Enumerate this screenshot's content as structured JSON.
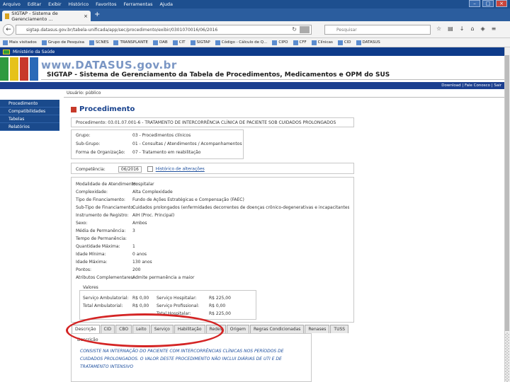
{
  "browser": {
    "menu": [
      "Arquivo",
      "Editar",
      "Exibir",
      "Histórico",
      "Favoritos",
      "Ferramentas",
      "Ajuda"
    ],
    "tab_title": "SIGTAP - Sistema de Gerenciamento ...",
    "url": "sigtap.datasus.gov.br/tabela-unificada/app/sec/procedimento/exibir/0301070016/06/2016",
    "search_placeholder": "Pesquisar",
    "bookmarks": [
      "Mais visitados",
      "Grupo de Pesquisa",
      "SCNES",
      "TRANSPLANTE",
      "DAB",
      "CIT",
      "SIGTAP",
      "Código - Cálculo de Q...",
      "CIPO",
      "CFF",
      "Clínicas",
      "CID",
      "DATASUS"
    ]
  },
  "page": {
    "gov_label": "Ministério da Saúde",
    "brand": "www.DATASUS.gov.br",
    "system_title": "SIGTAP - Sistema de Gerenciamento da Tabela de Procedimentos, Medicamentos e OPM do SUS",
    "top_links": "Download | Fale Conosco | Sair",
    "user": "Usuário: público",
    "sidebar": [
      "Procedimento",
      "Compatibilidades",
      "Tabelas",
      "Relatórios"
    ],
    "title": "Procedimento",
    "procedure": {
      "label": "Procedimento:",
      "value": "03.01.07.001-6 - TRATAMENTO DE INTERCORRÊNCIA CLÍNICA DE PACIENTE SOB CUIDADOS PROLONGADOS"
    },
    "hierarchy": [
      {
        "label": "Grupo:",
        "value": "03 - Procedimentos clínicos"
      },
      {
        "label": "Sub-Grupo:",
        "value": "01 - Consultas / Atendimentos / Acompanhamentos"
      },
      {
        "label": "Forma de Organização:",
        "value": "07 - Tratamento em reabilitação"
      }
    ],
    "competencia": {
      "label": "Competência:",
      "value": "06/2016",
      "history_label": "Histórico de alterações"
    },
    "attributes": [
      {
        "label": "Modalidade de Atendimento:",
        "value": "Hospitalar"
      },
      {
        "label": "Complexidade:",
        "value": "Alta Complexidade"
      },
      {
        "label": "Tipo de Financiamento:",
        "value": "Fundo de Ações Estratégicas e Compensação (FAEC)"
      },
      {
        "label": "Sub-Tipo de Financiamento:",
        "value": "Cuidados prolongados (enfermidades decorrentes de doenças crônico-degenerativas e incapacitantes)"
      },
      {
        "label": "Instrumento de Registro:",
        "value": "AIH (Proc. Principal)"
      },
      {
        "label": "Sexo:",
        "value": "Ambos"
      },
      {
        "label": "Média de Permanência:",
        "value": "3"
      },
      {
        "label": "Tempo de Permanência:",
        "value": ""
      },
      {
        "label": "Quantidade Máxima:",
        "value": "1"
      },
      {
        "label": "Idade Mínima:",
        "value": "0 anos"
      },
      {
        "label": "Idade Máxima:",
        "value": "130 anos"
      },
      {
        "label": "Pontos:",
        "value": "200"
      },
      {
        "label": "Atributos Complementares:",
        "value": "Admite permanência a maior"
      }
    ],
    "values_title": "Valores",
    "values": [
      {
        "l1": "Serviço Ambulatorial:",
        "v1": "R$ 0,00",
        "l2": "Serviço Hospitalar:",
        "v2": "R$ 225,00"
      },
      {
        "l1": "Total Ambulatorial:",
        "v1": "R$ 0,00",
        "l2": "Serviço Profissional:",
        "v2": "R$ 0,00"
      },
      {
        "l1": "",
        "v1": "",
        "l2": "Total Hospitalar:",
        "v2": "R$ 225,00"
      }
    ],
    "tabs": [
      "Descrição",
      "CID",
      "CBO",
      "Leito",
      "Serviço",
      "Habilitação",
      "Redes",
      "Origem",
      "Regras Condicionadas",
      "Renases",
      "TUSS"
    ],
    "description_title": "Descrição",
    "description_text": "Consiste na internação do paciente com intercorrências clínicas nos períodos de cuidados prolongados. O valor deste procedimento não inclui diárias de UTI e de tratamento intensivo"
  }
}
